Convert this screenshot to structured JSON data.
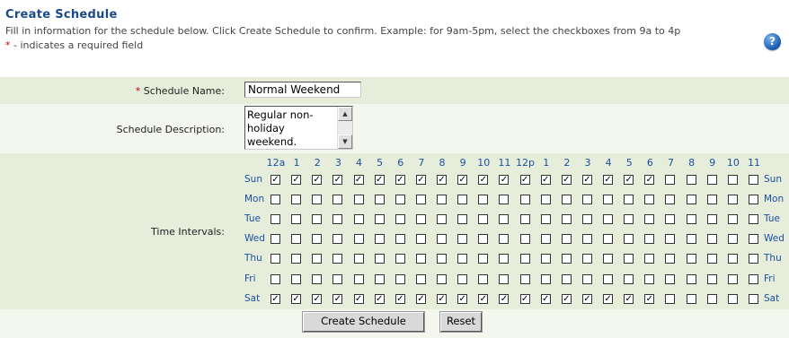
{
  "header": {
    "title": "Create Schedule",
    "instructions": "Fill in information for the schedule below. Click Create Schedule to confirm. Example: for 9am-5pm, select the checkboxes from 9a to 4p",
    "required_marker": "*",
    "required_note": " - indicates a required field",
    "help_label": "?"
  },
  "form": {
    "name_label": "Schedule Name:",
    "name_value": "Normal Weekend",
    "description_label": "Schedule Description:",
    "description_value": "Regular non-holiday weekend.",
    "time_label": "Time Intervals:",
    "hours": [
      "12a",
      "1",
      "2",
      "3",
      "4",
      "5",
      "6",
      "7",
      "8",
      "9",
      "10",
      "11",
      "12p",
      "1",
      "2",
      "3",
      "4",
      "5",
      "6",
      "7",
      "8",
      "9",
      "10",
      "11"
    ],
    "days": [
      {
        "name": "Sun",
        "checked": [
          1,
          1,
          1,
          1,
          1,
          1,
          1,
          1,
          1,
          1,
          1,
          1,
          1,
          1,
          1,
          1,
          1,
          1,
          1,
          0,
          0,
          0,
          0,
          0
        ]
      },
      {
        "name": "Mon",
        "checked": [
          0,
          0,
          0,
          0,
          0,
          0,
          0,
          0,
          0,
          0,
          0,
          0,
          0,
          0,
          0,
          0,
          0,
          0,
          0,
          0,
          0,
          0,
          0,
          0
        ]
      },
      {
        "name": "Tue",
        "checked": [
          0,
          0,
          0,
          0,
          0,
          0,
          0,
          0,
          0,
          0,
          0,
          0,
          0,
          0,
          0,
          0,
          0,
          0,
          0,
          0,
          0,
          0,
          0,
          0
        ]
      },
      {
        "name": "Wed",
        "checked": [
          0,
          0,
          0,
          0,
          0,
          0,
          0,
          0,
          0,
          0,
          0,
          0,
          0,
          0,
          0,
          0,
          0,
          0,
          0,
          0,
          0,
          0,
          0,
          0
        ]
      },
      {
        "name": "Thu",
        "checked": [
          0,
          0,
          0,
          0,
          0,
          0,
          0,
          0,
          0,
          0,
          0,
          0,
          0,
          0,
          0,
          0,
          0,
          0,
          0,
          0,
          0,
          0,
          0,
          0
        ]
      },
      {
        "name": "Fri",
        "checked": [
          0,
          0,
          0,
          0,
          0,
          0,
          0,
          0,
          0,
          0,
          0,
          0,
          0,
          0,
          0,
          0,
          0,
          0,
          0,
          0,
          0,
          0,
          0,
          0
        ]
      },
      {
        "name": "Sat",
        "checked": [
          1,
          1,
          1,
          1,
          1,
          1,
          1,
          1,
          1,
          1,
          1,
          1,
          1,
          1,
          1,
          1,
          1,
          1,
          1,
          0,
          0,
          0,
          0,
          0
        ]
      }
    ]
  },
  "buttons": {
    "create_label": "Create Schedule",
    "reset_label": "Reset"
  },
  "colors": {
    "title": "#1a4a8a",
    "link_blue": "#1a4fa0",
    "band_dark": "#e6eedb",
    "band_light": "#f4f7ee",
    "required_red": "#cc0000"
  }
}
